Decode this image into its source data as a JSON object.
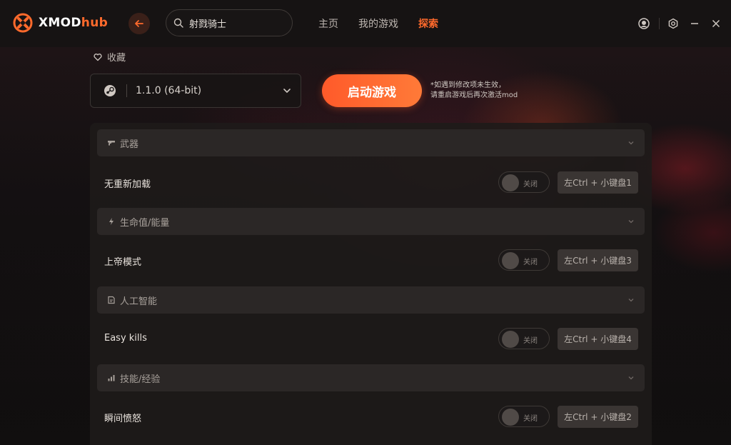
{
  "app": {
    "logo_main": "XMOD",
    "logo_accent": "hub"
  },
  "search": {
    "value": "射戮骑士"
  },
  "nav": {
    "home": "主页",
    "my_games": "我的游戏",
    "explore": "探索"
  },
  "favorite": {
    "label": "收藏"
  },
  "version": {
    "value": "1.1.0 (64-bit)"
  },
  "launch": {
    "label": "启动游戏",
    "note_line1": "*如遇到修改项未生效，",
    "note_line2": "请重启游戏后再次激活mod"
  },
  "sections": [
    {
      "title": "武器",
      "icon": "gun-icon"
    },
    {
      "title": "生命值/能量",
      "icon": "lightning-icon"
    },
    {
      "title": "人工智能",
      "icon": "ai-icon"
    },
    {
      "title": "技能/经验",
      "icon": "bar-chart-icon"
    }
  ],
  "mods": [
    {
      "name": "无重新加载",
      "state": "关闭",
      "hotkey": "左Ctrl + 小键盘1"
    },
    {
      "name": "上帝模式",
      "state": "关闭",
      "hotkey": "左Ctrl + 小键盘3"
    },
    {
      "name": "Easy kills",
      "state": "关闭",
      "hotkey": "左Ctrl + 小键盘4"
    },
    {
      "name": "瞬间愤怒",
      "state": "关闭",
      "hotkey": "左Ctrl + 小键盘2"
    }
  ],
  "colors": {
    "accent": "#ff6a2c",
    "background": "#121010",
    "panel": "#1e1b1a"
  }
}
